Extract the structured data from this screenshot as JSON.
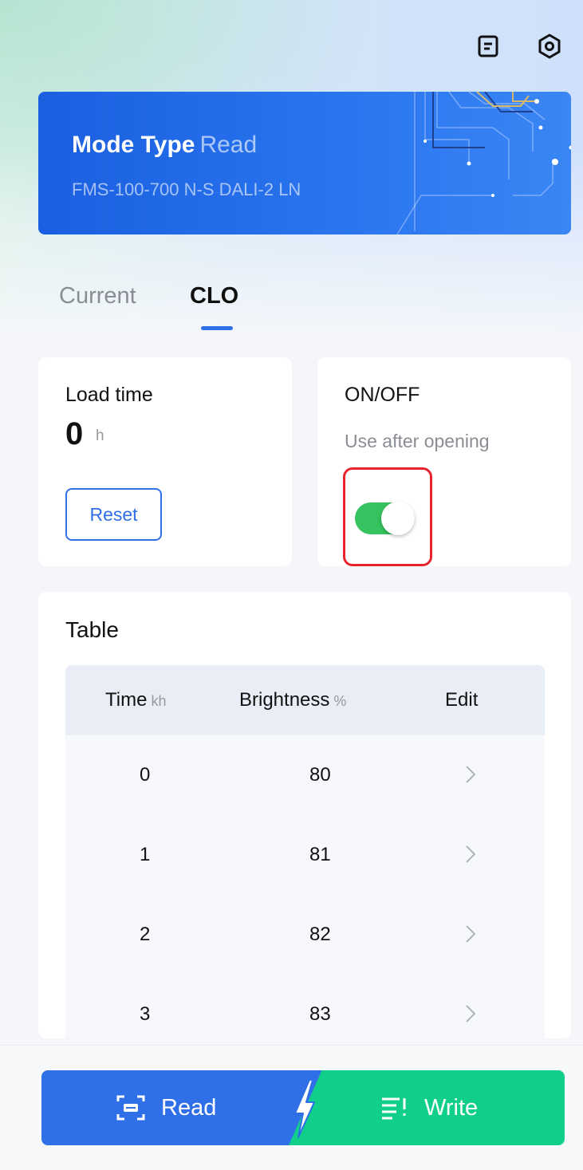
{
  "header": {
    "icons": [
      "document-icon",
      "settings-icon"
    ]
  },
  "banner": {
    "title_bold": "Mode Type",
    "title_light": "Read",
    "model": "FMS-100-700 N-S DALI-2 LN"
  },
  "tabs": [
    {
      "label": "Current",
      "active": false
    },
    {
      "label": "CLO",
      "active": true
    }
  ],
  "load_time": {
    "label": "Load time",
    "value": "0",
    "unit": "h",
    "reset_label": "Reset"
  },
  "onoff": {
    "label": "ON/OFF",
    "hint": "Use after opening",
    "enabled": true
  },
  "table": {
    "title": "Table",
    "columns": [
      {
        "label": "Time",
        "unit": "kh"
      },
      {
        "label": "Brightness",
        "unit": "%"
      },
      {
        "label": "Edit",
        "unit": ""
      }
    ],
    "rows": [
      {
        "time": "0",
        "brightness": "80"
      },
      {
        "time": "1",
        "brightness": "81"
      },
      {
        "time": "2",
        "brightness": "82"
      },
      {
        "time": "3",
        "brightness": "83"
      }
    ]
  },
  "actions": {
    "read_label": "Read",
    "write_label": "Write"
  },
  "colors": {
    "primary": "#2f6fe8",
    "write": "#10cf8a",
    "toggle_on": "#36c25e",
    "highlight": "#e8232b"
  }
}
